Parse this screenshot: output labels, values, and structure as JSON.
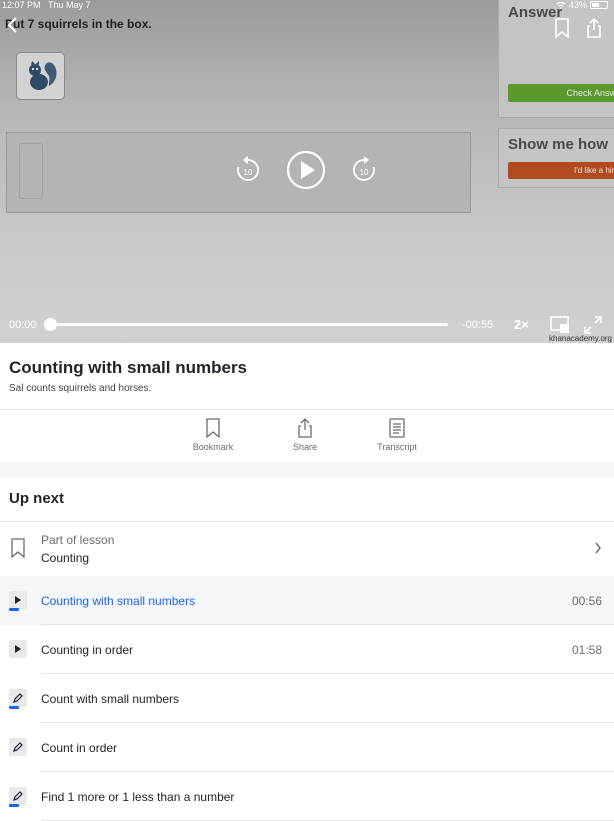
{
  "status_bar": {
    "time": "12:07 PM",
    "date": "Thu May 7",
    "battery": "43%"
  },
  "video": {
    "prompt": "Put 7 squirrels in the box.",
    "side_answer_title": "Answer",
    "check_answer": "Check Answ",
    "show_me_how": "Show me how",
    "hint": "I'd like a hin",
    "rewind_seconds": "10",
    "forward_seconds": "10",
    "time_current": "00:00",
    "time_remaining": "-00:55",
    "speed": "2×",
    "watermark": "khanacademy.org",
    "progress": 0
  },
  "info": {
    "title": "Counting with small numbers",
    "description": "Sal counts squirrels and horses."
  },
  "actions": [
    {
      "label": "Bookmark",
      "icon": "bookmark-icon"
    },
    {
      "label": "Share",
      "icon": "share-icon"
    },
    {
      "label": "Transcript",
      "icon": "transcript-icon"
    }
  ],
  "up_next": {
    "heading": "Up next",
    "lesson": {
      "prefix": "Part of lesson",
      "name": "Counting"
    },
    "items": [
      {
        "label": "Counting with small numbers",
        "duration": "00:56",
        "type": "video",
        "active": true
      },
      {
        "label": "Counting in order",
        "duration": "01:58",
        "type": "video",
        "active": false
      },
      {
        "label": "Count with small numbers",
        "duration": "",
        "type": "exercise",
        "active": false
      },
      {
        "label": "Count in order",
        "duration": "",
        "type": "exercise",
        "active": false
      },
      {
        "label": "Find 1 more or 1 less than a number",
        "duration": "",
        "type": "exercise",
        "active": false
      }
    ]
  },
  "colors": {
    "accent": "#1865f2",
    "check_green": "#5a9a2c",
    "hint_orange": "#b24a1e"
  }
}
